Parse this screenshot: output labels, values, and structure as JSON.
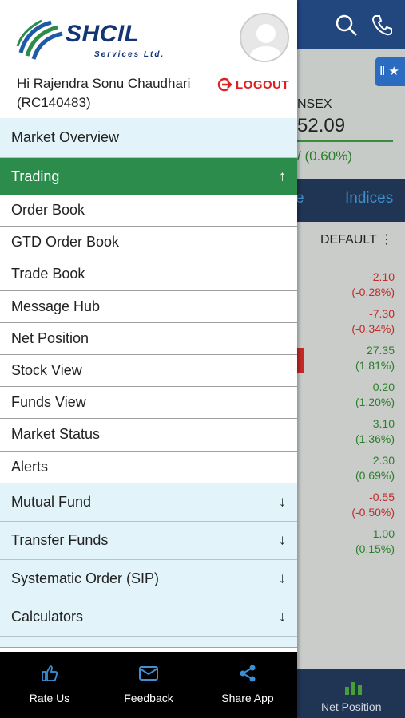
{
  "background": {
    "index_name": "NSEX",
    "index_value": "52.09",
    "index_change": "/ (0.60%)",
    "tab_partial": "e",
    "tab_indices": "Indices",
    "sort_label": "DEFAULT ⋮",
    "rows": [
      {
        "change": "-2.10",
        "pct": "(-0.28%)",
        "dir": "neg"
      },
      {
        "change": "-7.30",
        "pct": "(-0.34%)",
        "dir": "neg"
      },
      {
        "change": "27.35",
        "pct": "(1.81%)",
        "dir": "pos"
      },
      {
        "change": "0.20",
        "pct": "(1.20%)",
        "dir": "pos"
      },
      {
        "change": "3.10",
        "pct": "(1.36%)",
        "dir": "pos"
      },
      {
        "change": "2.30",
        "pct": "(0.69%)",
        "dir": "pos"
      },
      {
        "change": "-0.55",
        "pct": "(-0.50%)",
        "dir": "neg"
      },
      {
        "change": "1.00",
        "pct": "(0.15%)",
        "dir": "pos"
      }
    ],
    "bottom_label": "Net Position"
  },
  "drawer": {
    "brand": "SHCIL",
    "brand_sub": "Services Ltd.",
    "greeting_line1": "Hi Rajendra Sonu Chaudhari",
    "greeting_line2": "(RC140483)",
    "logout": "LOGOUT",
    "menu": {
      "market_overview": "Market Overview",
      "trading": "Trading",
      "order_book": "Order Book",
      "gtd_order_book": "GTD Order Book",
      "trade_book": "Trade Book",
      "message_hub": "Message Hub",
      "net_position": "Net Position",
      "stock_view": "Stock View",
      "funds_view": "Funds View",
      "market_status": "Market Status",
      "alerts": "Alerts",
      "mutual_fund": "Mutual Fund",
      "transfer_funds": "Transfer Funds",
      "systematic_order": "Systematic Order (SIP)",
      "calculators": "Calculators"
    },
    "bottom": {
      "rate_us": "Rate Us",
      "feedback": "Feedback",
      "share_app": "Share App"
    }
  },
  "colors": {
    "header_blue": "#22477e",
    "active_green": "#2c8c4c",
    "light_blue_row": "#e2f3fa",
    "logout_red": "#e02020",
    "positive": "#2b7f2b",
    "negative": "#c52929"
  }
}
